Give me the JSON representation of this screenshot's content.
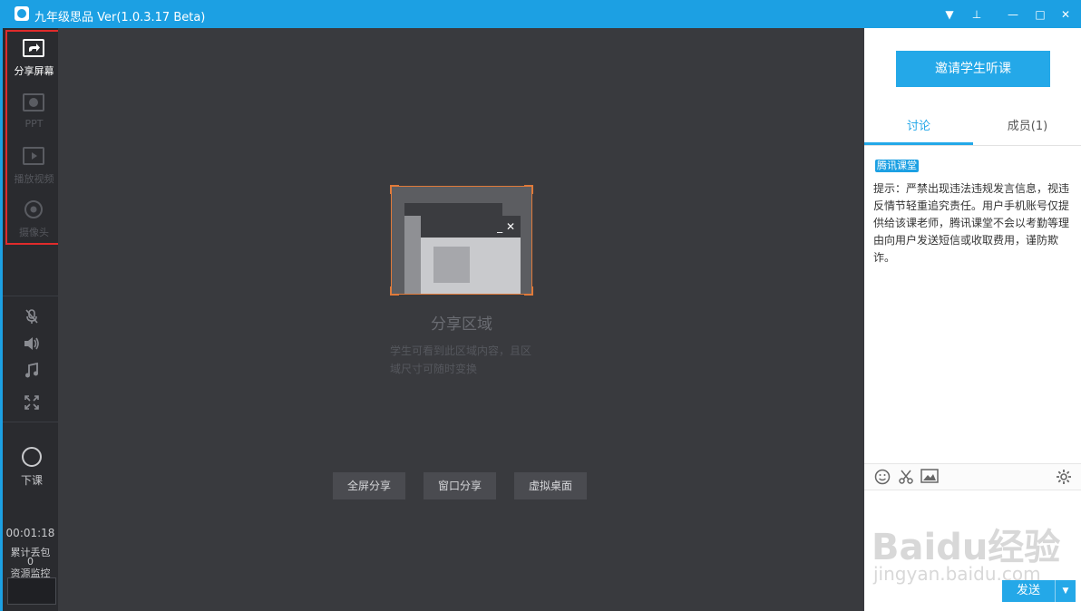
{
  "window": {
    "title": "九年级思品 Ver(1.0.3.17 Beta)",
    "controls": {
      "dropdown": "▼",
      "pin": "⊥",
      "minimize": "—",
      "maximize": "□",
      "close": "✕"
    }
  },
  "toolbar": {
    "items": [
      {
        "label": "分享屏幕",
        "icon": "share-screen-icon",
        "active": true
      },
      {
        "label": "PPT",
        "icon": "ppt-icon",
        "active": false
      },
      {
        "label": "播放视频",
        "icon": "play-video-icon",
        "active": false
      },
      {
        "label": "摄像头",
        "icon": "camera-icon",
        "active": false
      }
    ],
    "audio_icons": [
      "mic-muted-icon",
      "speaker-icon",
      "music-icon",
      "fullscreen-icon"
    ],
    "end_class_label": "下课",
    "timer": "00:01:18",
    "packet_loss_label": "累计丢包",
    "packet_loss_value": "0",
    "resource_monitor_label": "资源监控"
  },
  "share": {
    "title": "分享区域",
    "description": "学生可看到此区域内容，且区域尺寸可随时变换",
    "buttons": [
      "全屏分享",
      "窗口分享",
      "虚拟桌面"
    ]
  },
  "right_panel": {
    "invite_button": "邀请学生听课",
    "tabs": [
      {
        "label": "讨论",
        "active": true
      },
      {
        "label": "成员(1)",
        "active": false
      }
    ],
    "badge": "腾讯课堂",
    "notice": "提示：严禁出现违法违规发言信息，视违反情节轻重追究责任。用户手机账号仅提供给该课老师，腾讯课堂不会以考勤等理由向用户发送短信或收取费用，谨防欺诈。",
    "input_icons": [
      "emoji-icon",
      "scissors-icon",
      "image-icon",
      "settings-icon"
    ],
    "send_button": "发送",
    "watermark_line1": "Baidu经验",
    "watermark_line2": "jingyan.baidu.com"
  },
  "colors": {
    "accent": "#1ca0e3",
    "highlight_border": "#e02b2b",
    "share_frame": "#e07a3a"
  }
}
